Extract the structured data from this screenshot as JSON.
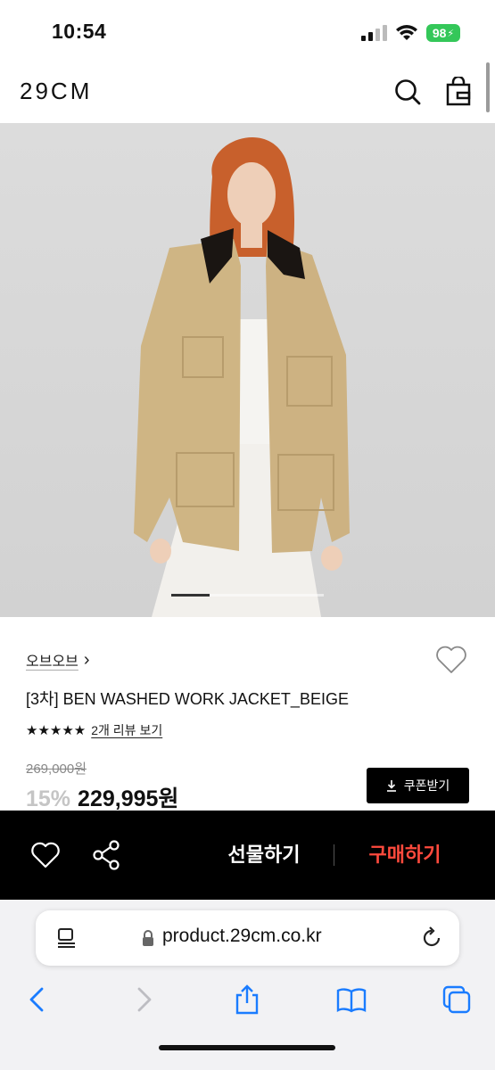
{
  "status_bar": {
    "time": "10:54",
    "battery": "98"
  },
  "header": {
    "logo": "29CM",
    "search_icon": "search-icon",
    "bag_icon": "shopping-bag-icon"
  },
  "product": {
    "brand": "오브오브",
    "brand_chevron": "›",
    "title": "[3차] BEN WASHED WORK JACKET_BEIGE",
    "stars": "★★★★★",
    "review_link": "2개 리뷰 보기",
    "original_price": "269,000원",
    "discount": "15%",
    "price": "229,995원",
    "coupon_button": "쿠폰받기",
    "image_index": 1,
    "image_count": 4
  },
  "action_bar": {
    "gift_label": "선물하기",
    "buy_label": "구매하기",
    "buy_color": "#ff4a3d"
  },
  "browser": {
    "url": "product.29cm.co.kr"
  }
}
